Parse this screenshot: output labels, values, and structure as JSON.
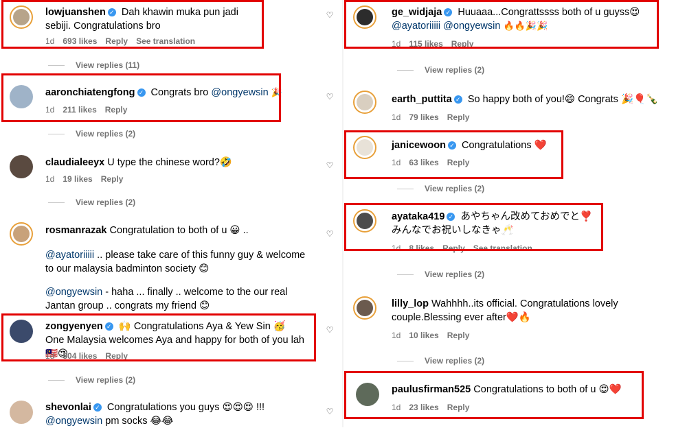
{
  "left": {
    "comments": [
      {
        "user": "lowjuanshen",
        "verified": true,
        "text": "Dah khawin muka pun jadi sebiji. Congratulations bro",
        "age": "1d",
        "likes": "693 likes",
        "reply": "Reply",
        "translate": "See translation"
      },
      {
        "user": "aaronchiatengfong",
        "verified": true,
        "text": "Congrats bro",
        "mention": "@ongyewsin",
        "emoji": "🎉",
        "age": "1d",
        "likes": "211 likes",
        "reply": "Reply"
      },
      {
        "user": "claudialeeyx",
        "verified": false,
        "text": "U type the chinese word?🤣",
        "age": "1d",
        "likes": "19 likes",
        "reply": "Reply"
      },
      {
        "user": "rosmanrazak",
        "verified": false,
        "text": "Congratulation to both of u 😀 ..",
        "p2_mention": "@ayatoriiiii",
        "p2_text": ".. please take care of this funny guy & welcome to our malaysia badminton society 😊",
        "p3_mention": "@ongyewsin",
        "p3_text": "- haha ... finally .. welcome to the our real Jantan group .. congrats my friend 😊"
      },
      {
        "user": "zongyenyen",
        "verified": true,
        "text": "🙌 Congratulations Aya & Yew Sin 🥳 One Malaysia welcomes Aya and happy for both of you lah 🇲🇾😍",
        "age": "1d",
        "likes": "504 likes",
        "reply": "Reply"
      },
      {
        "user": "shevonlai",
        "verified": true,
        "text": "Congratulations you guys 😍😍😍 !!!",
        "mention2": "@ongyewsin",
        "text2": "pm socks 😂😂"
      }
    ],
    "view_replies": [
      "View replies (11)",
      "View replies (2)",
      "View replies (2)",
      "View replies (2)"
    ]
  },
  "right": {
    "comments": [
      {
        "user": "ge_widjaja",
        "verified": true,
        "text": "Huuaaa...Congrattssss both of u guyss😍",
        "mention_a": "@ayatoriiiii",
        "mention_b": "@ongyewsin",
        "emoji": "🔥🔥🎉🎉",
        "age": "1d",
        "likes": "115 likes",
        "reply": "Reply"
      },
      {
        "user": "earth_puttita",
        "verified": true,
        "text": "So happy both of you!😄 Congrats 🎉🎈🍾",
        "age": "1d",
        "likes": "79 likes",
        "reply": "Reply"
      },
      {
        "user": "janicewoon",
        "verified": true,
        "text": "Congratulations ❤️",
        "age": "1d",
        "likes": "63 likes",
        "reply": "Reply"
      },
      {
        "user": "ayataka419",
        "verified": true,
        "text": "あやちゃん改めておめでと❣️",
        "text2": "みんなでお祝いしなきゃ🥂",
        "age": "1d",
        "likes": "8 likes",
        "reply": "Reply",
        "translate": "See translation"
      },
      {
        "user": "lilly_lop",
        "verified": false,
        "text": "Wahhhh..its official. Congratulations lovely couple.Blessing ever after❤️🔥",
        "age": "1d",
        "likes": "10 likes",
        "reply": "Reply"
      },
      {
        "user": "paulusfirman525",
        "verified": false,
        "text": "Congratulations to both of u 😍❤️",
        "age": "1d",
        "likes": "23 likes",
        "reply": "Reply"
      }
    ],
    "view_replies": [
      "View replies (2)",
      "View replies (2)",
      "View replies (2)",
      "View replies (2)"
    ]
  },
  "colors": {
    "highlight": "#e20000",
    "muted": "#737373",
    "mention": "#00376b",
    "verified": "#3897f0"
  }
}
